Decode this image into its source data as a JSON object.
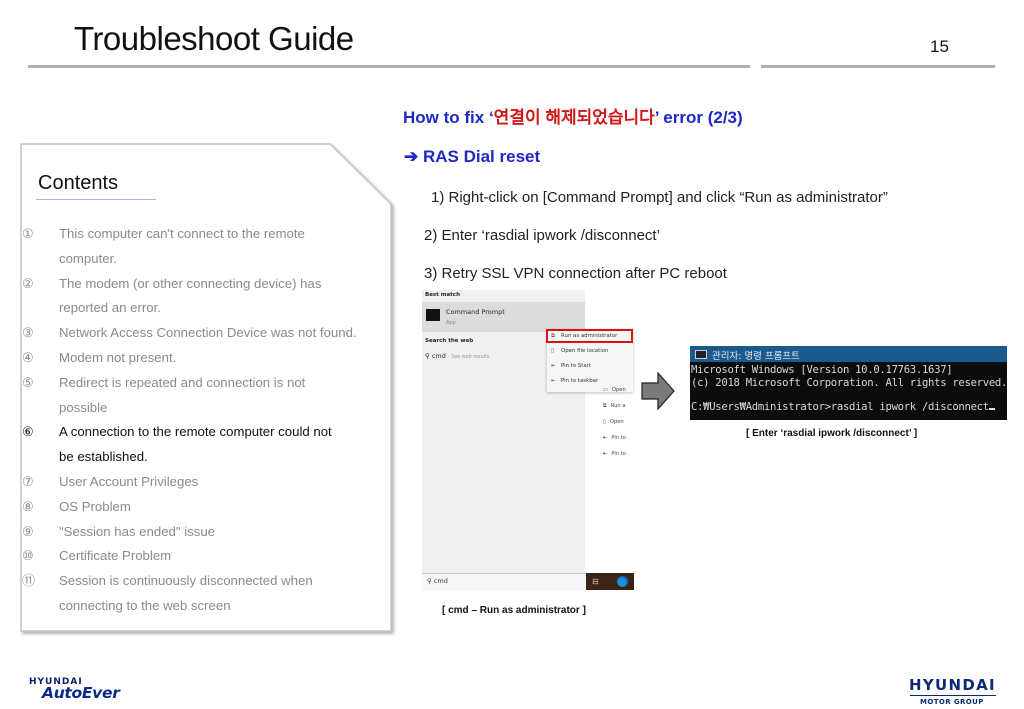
{
  "header": {
    "title": "Troubleshoot Guide",
    "page_number": "15"
  },
  "contents": {
    "title": "Contents",
    "items": [
      {
        "num": "①",
        "lines": [
          "This computer can't connect to the remote",
          "computer."
        ],
        "active": false
      },
      {
        "num": "②",
        "lines": [
          "The modem (or other connecting device) has",
          "reported an error."
        ],
        "active": false
      },
      {
        "num": "③",
        "lines": [
          "Network Access Connection Device was not found."
        ],
        "active": false
      },
      {
        "num": "④",
        "lines": [
          "Modem not present."
        ],
        "active": false
      },
      {
        "num": "⑤",
        "lines": [
          "Redirect is repeated and connection is not",
          "possible"
        ],
        "active": false
      },
      {
        "num": "⑥",
        "lines": [
          "A connection to the remote computer could not",
          "be established."
        ],
        "active": true
      },
      {
        "num": "⑦",
        "lines": [
          "User Account Privileges"
        ],
        "active": false
      },
      {
        "num": "⑧",
        "lines": [
          "OS Problem"
        ],
        "active": false
      },
      {
        "num": "⑨",
        "lines": [
          "\"Session has ended\" issue"
        ],
        "active": false
      },
      {
        "num": "⑩",
        "lines": [
          "Certificate Problem"
        ],
        "active": false
      },
      {
        "num": "⑪",
        "lines": [
          "Session is continuously disconnected when",
          "connecting to the web screen"
        ],
        "active": false
      }
    ]
  },
  "main": {
    "howto_prefix": "How to fix ‘",
    "howto_korean": "연결이 해제되었습니다",
    "howto_suffix": "’ error (2/3)",
    "section_arrow": "➔",
    "section_title": "RAS Dial reset",
    "steps": [
      "1) Right-click on [Command Prompt] and click “Run as administrator”",
      "2) Enter ‘rasdial ipwork /disconnect’",
      "3) Retry SSL VPN connection after PC reboot"
    ]
  },
  "start_menu": {
    "best_match_label": "Best match",
    "app_name": "Command Prompt",
    "app_type": "App",
    "search_web_label": "Search the web",
    "search_query": "cmd",
    "search_sub": "- See web results",
    "context_menu": [
      {
        "icon": "⧉",
        "label": "Run as administrator"
      },
      {
        "icon": "▯",
        "label": "Open file location"
      },
      {
        "icon": "⇤",
        "label": "Pin to Start"
      },
      {
        "icon": "⇤",
        "label": "Pin to taskbar"
      }
    ],
    "side_items": [
      {
        "icon": "▭",
        "label": "Open"
      },
      {
        "icon": "⧉",
        "label": "Run a"
      },
      {
        "icon": "▯",
        "label": "Open"
      },
      {
        "icon": "⇤",
        "label": "Pin to"
      },
      {
        "icon": "⇤",
        "label": "Pin to"
      }
    ],
    "taskbar_search_text": "cmd",
    "caption": "[ cmd – Run as administrator ]"
  },
  "console": {
    "title": "관리자: 명령 프롬프트",
    "lines": [
      "Microsoft Windows [Version 10.0.17763.1637]",
      "(c) 2018 Microsoft Corporation. All rights reserved.",
      "",
      "C:₩Users₩Administrator>rasdial ipwork /disconnect"
    ],
    "caption": "[ Enter ‘rasdial ipwork /disconnect’ ]"
  },
  "footer": {
    "left_logo_top": "HYUNDAI",
    "left_logo_main": "AutoEver",
    "right_logo_main": "HYUNDAI",
    "right_logo_sub": "MOTOR GROUP"
  },
  "colors": {
    "heading_blue": "#1e28c8",
    "korean_red": "#d01818",
    "highlight_red": "#e01010",
    "brand_navy": "#0a2a78"
  }
}
